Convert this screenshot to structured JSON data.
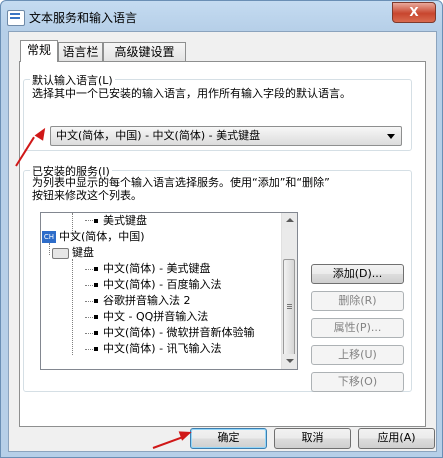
{
  "window": {
    "title": "文本服务和输入语言",
    "close_label": "X"
  },
  "tabs": [
    {
      "label": "常规",
      "active": true
    },
    {
      "label": "语言栏",
      "active": false
    },
    {
      "label": "高级键设置",
      "active": false
    }
  ],
  "default_language": {
    "title": "默认输入语言(L)",
    "description": "选择其中一个已安装的输入语言，用作所有输入字段的默认语言。",
    "selected": "中文(简体，中国) - 中文(简体) - 美式键盘"
  },
  "installed_services": {
    "title": "已安装的服务(I)",
    "description_line1": "为列表中显示的每个输入语言选择服务。使用“添加”和“删除”",
    "description_line2": "按钮来修改这个列表。",
    "tree": {
      "partial_item": "美式键盘",
      "language": "中文(简体，中国)",
      "language_icon": "CH",
      "category": "键盘",
      "items": [
        "中文(简体) - 美式键盘",
        "中文(简体) - 百度输入法",
        "谷歌拼音输入法 2",
        "中文 - QQ拼音输入法",
        "中文(简体) - 微软拼音新体验输",
        "中文(简体) - 讯飞输入法"
      ]
    },
    "buttons": {
      "add": "添加(D)...",
      "remove": "删除(R)",
      "properties": "属性(P)...",
      "move_up": "上移(U)",
      "move_down": "下移(O)"
    }
  },
  "footer": {
    "ok": "确定",
    "cancel": "取消",
    "apply": "应用(A)"
  },
  "colors": {
    "annotation_arrow": "#d01818",
    "window_frame": "#b6cfe8"
  }
}
